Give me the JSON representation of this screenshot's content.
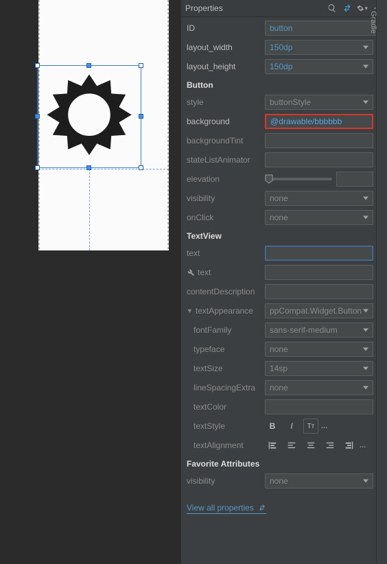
{
  "panel": {
    "title": "Properties"
  },
  "side_tab": "Gradle",
  "props": {
    "id_label": "ID",
    "id_value": "button",
    "layout_width_label": "layout_width",
    "layout_width_value": "150dp",
    "layout_height_label": "layout_height",
    "layout_height_value": "150dp",
    "button_section": "Button",
    "style_label": "style",
    "style_value": "buttonStyle",
    "background_label": "background",
    "background_value": "@drawable/bbbbbb",
    "backgroundTint_label": "backgroundTint",
    "stateListAnimator_label": "stateListAnimator",
    "elevation_label": "elevation",
    "visibility_label": "visibility",
    "visibility_value": "none",
    "onClick_label": "onClick",
    "onClick_value": "none",
    "textview_section": "TextView",
    "text_label": "text",
    "text2_label": "text",
    "contentDescription_label": "contentDescription",
    "textAppearance_label": "textAppearance",
    "textAppearance_value": "ppCompat.Widget.Button",
    "fontFamily_label": "fontFamily",
    "fontFamily_value": "sans-serif-medium",
    "typeface_label": "typeface",
    "typeface_value": "none",
    "textSize_label": "textSize",
    "textSize_value": "14sp",
    "lineSpacingExtra_label": "lineSpacingExtra",
    "lineSpacingExtra_value": "none",
    "textColor_label": "textColor",
    "textStyle_label": "textStyle",
    "textAlignment_label": "textAlignment",
    "favorite_section": "Favorite Attributes",
    "fav_visibility_label": "visibility",
    "fav_visibility_value": "none"
  },
  "footer": {
    "link": "View all properties"
  }
}
